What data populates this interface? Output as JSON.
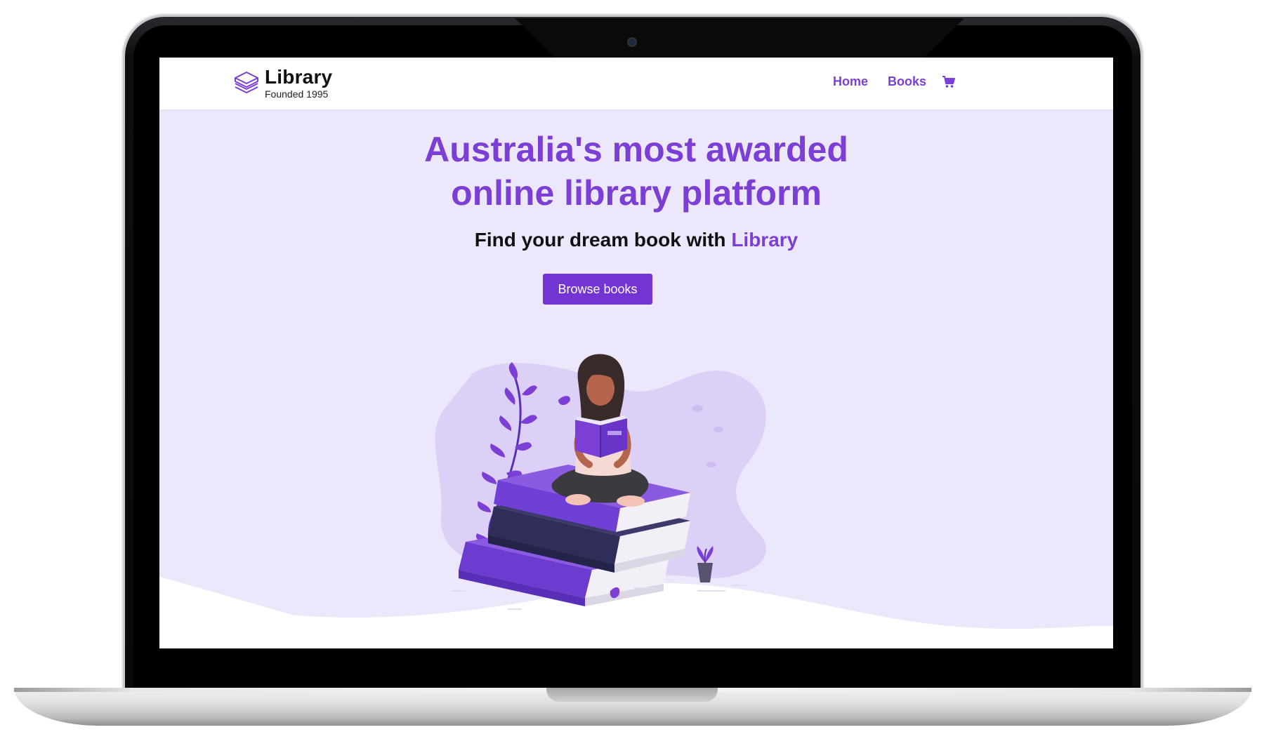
{
  "nav": {
    "logo_title": "Library",
    "logo_subtitle": "Founded 1995",
    "links": [
      "Home",
      "Books"
    ],
    "cart_icon": "shopping-cart-icon"
  },
  "hero": {
    "title_line1": "Australia's most awarded",
    "title_line2": "online library platform",
    "subtitle_prefix": "Find your dream book with",
    "subtitle_accent": "Library",
    "button_label": "Browse books"
  },
  "colors": {
    "brand": "#7b3fd6",
    "button": "#7235d4",
    "hero_background": "#ede7fb",
    "navbar_background": "#ffffff"
  }
}
